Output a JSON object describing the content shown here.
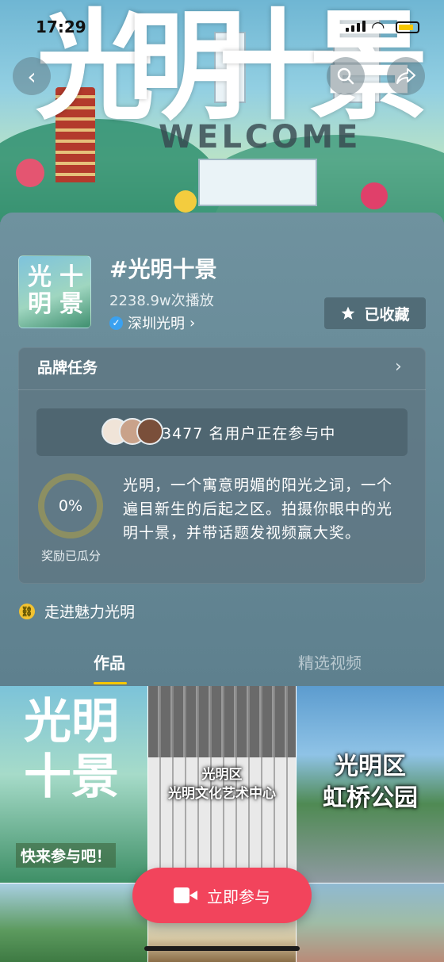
{
  "status_bar": {
    "time": "17:29"
  },
  "banner": {
    "title_chars": [
      "光",
      "明",
      "十",
      "景"
    ],
    "welcome_text": "WELCOME"
  },
  "topic": {
    "title": "#光明十景",
    "plays": "2238.9w次播放",
    "author": "深圳光明",
    "author_chevron": "›",
    "favorite_label": "已收藏",
    "thumb_chars": [
      "光",
      "明",
      "十",
      "景"
    ]
  },
  "task": {
    "heading": "品牌任务",
    "participants_text": "3477 名用户正在参与中",
    "progress_value": 0,
    "progress_label": "0%",
    "reward_label": "奖励已瓜分",
    "description": "光明，一个寓意明媚的阳光之词，一个遍目新生的后起之区。拍摄你眼中的光明十景，并带话题发视频赢大奖。"
  },
  "link": {
    "label": "走进魅力光明"
  },
  "tabs": [
    {
      "label": "作品",
      "active": true
    },
    {
      "label": "精选视频",
      "active": false
    }
  ],
  "grid": {
    "items": [
      {
        "overlay": "光明十景",
        "sub": "快来参与吧！"
      },
      {
        "overlay": "光明区\n光明文化艺术中心"
      },
      {
        "overlay": "光明区\n虹桥公园"
      }
    ]
  },
  "join_button": {
    "label": "立即参与"
  },
  "colors": {
    "accent": "#f2445c",
    "tab_underline": "#f6c700",
    "panel": "#5f7f8c",
    "verified": "#3aa1f0"
  }
}
